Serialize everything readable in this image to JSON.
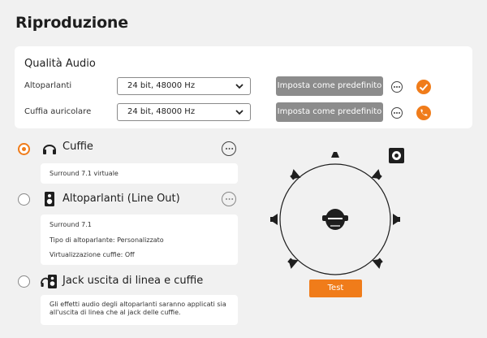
{
  "page": {
    "title": "Riproduzione"
  },
  "audio_quality": {
    "title": "Qualità Audio",
    "rows": [
      {
        "label": "Altoparlanti",
        "value": "24 bit, 48000 Hz",
        "button": "Imposta come predefinito",
        "status_icon": "checkmark-icon"
      },
      {
        "label": "Cuffia auricolare",
        "value": "24 bit, 48000 Hz",
        "button": "Imposta come predefinito",
        "status_icon": "phone-icon"
      }
    ]
  },
  "outputs": [
    {
      "label": "Cuffie",
      "selected": true,
      "icon": "headphones-icon",
      "details": [
        "Surround 7.1 virtuale"
      ]
    },
    {
      "label": "Altoparlanti (Line Out)",
      "selected": false,
      "icon": "speaker-icon",
      "details": [
        "Surround 7.1",
        "Tipo di altoparlante: Personalizzato",
        "Virtualizzazione cuffie: Off"
      ]
    },
    {
      "label": "Jack uscita di linea e cuffie",
      "selected": false,
      "icon": "speaker-headphones-icon",
      "details": [
        "Gli effetti audio degli altoparlanti saranno applicati sia all'uscita di linea che al jack delle cuffie."
      ]
    }
  ],
  "surround_diagram": {
    "test_button": "Test",
    "corner_icon": "speaker-box-icon"
  },
  "colors": {
    "accent": "#f07c1a",
    "button_gray": "#8c8c8c",
    "background": "#f1f1f1"
  }
}
